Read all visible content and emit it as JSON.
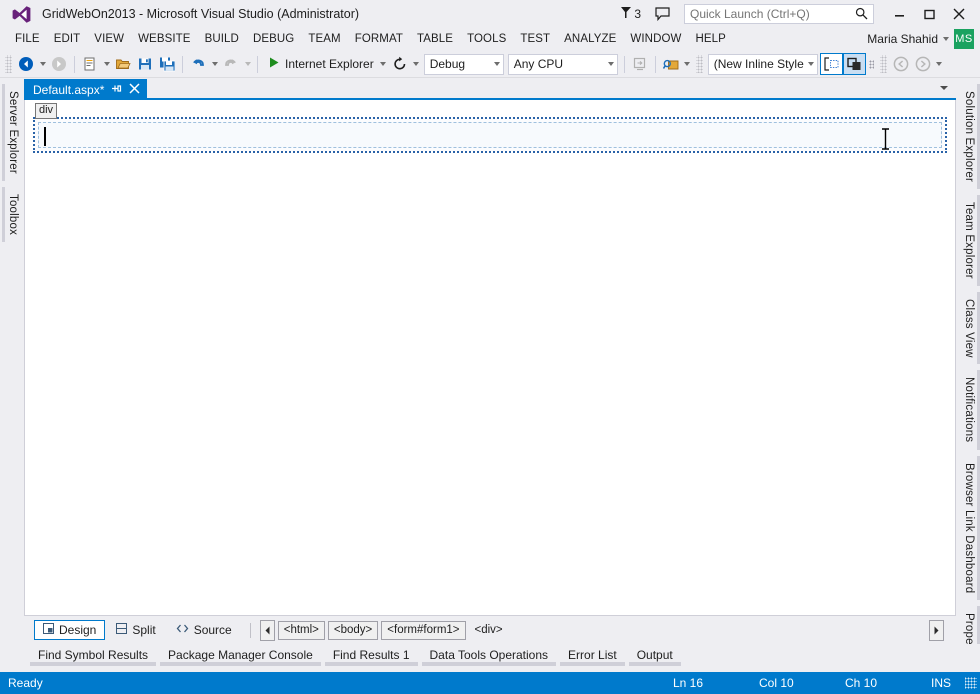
{
  "window": {
    "title": "GridWebOn2013 - Microsoft Visual Studio (Administrator)",
    "logo_icon": "visual-studio-logo",
    "minimize_label": "—",
    "maximize_label": "▢",
    "close_label": "✕"
  },
  "notifications": {
    "icon": "flag-icon",
    "count": "3"
  },
  "feedback": {
    "icon": "feedback-speech-bubble-icon"
  },
  "quick_launch": {
    "placeholder": "Quick Launch (Ctrl+Q)",
    "value": "",
    "icon": "search-icon"
  },
  "menu": {
    "items": [
      {
        "label": "FILE"
      },
      {
        "label": "EDIT"
      },
      {
        "label": "VIEW"
      },
      {
        "label": "WEBSITE"
      },
      {
        "label": "BUILD"
      },
      {
        "label": "DEBUG"
      },
      {
        "label": "TEAM"
      },
      {
        "label": "FORMAT"
      },
      {
        "label": "TABLE"
      },
      {
        "label": "TOOLS"
      },
      {
        "label": "TEST"
      },
      {
        "label": "ANALYZE"
      },
      {
        "label": "WINDOW"
      },
      {
        "label": "HELP"
      }
    ]
  },
  "account": {
    "name": "Maria Shahid",
    "initials": "MS",
    "avatar_color": "#1aa260"
  },
  "toolbar": {
    "nav_back_icon": "navigate-back-icon",
    "nav_forward_icon": "navigate-forward-icon",
    "new_item_icon": "new-item-icon",
    "open_file_icon": "open-file-icon",
    "save_icon": "save-icon",
    "save_all_icon": "save-all-icon",
    "undo_icon": "undo-icon",
    "redo_icon": "redo-icon",
    "start_debug_icon": "start-play-icon",
    "start_debug_label": "Internet Explorer",
    "refresh_icon": "refresh-icon",
    "configuration": "Debug",
    "platform": "Any CPU",
    "style_application": "(New Inline Style",
    "attach_icon": "attach-to-process-icon",
    "find_icon": "find-in-files-icon",
    "toggle_outline_icon": "show-block-selection-icon",
    "toggle_visual_aids_icon": "show-visual-aids-icon",
    "back_circle_icon": "back-circle-icon",
    "forward_circle_icon": "forward-circle-icon"
  },
  "left_dock": {
    "tabs": [
      {
        "label": "Server Explorer"
      },
      {
        "label": "Toolbox"
      }
    ]
  },
  "right_dock": {
    "tabs": [
      {
        "label": "Solution Explorer"
      },
      {
        "label": "Team Explorer"
      },
      {
        "label": "Class View"
      },
      {
        "label": "Notifications"
      },
      {
        "label": "Browser Link Dashboard"
      },
      {
        "label": "Properties"
      }
    ]
  },
  "document": {
    "tab_label": "Default.aspx*",
    "pin_icon": "pin-icon",
    "close_icon": "close-icon",
    "tab_list_icon": "tab-list-chevron-icon",
    "designer": {
      "tag_badge": "div",
      "content": "",
      "cursor_icon": "text-ibeam-cursor"
    }
  },
  "view_selector": {
    "buttons": [
      {
        "label": "Design",
        "icon": "design-view-icon",
        "active": true
      },
      {
        "label": "Split",
        "icon": "split-view-icon",
        "active": false
      },
      {
        "label": "Source",
        "icon": "source-view-icon",
        "active": false
      }
    ]
  },
  "tag_navigator": {
    "left_arrow_icon": "scroll-left-icon",
    "right_arrow_icon": "scroll-right-icon",
    "tags": [
      {
        "label": "<html>",
        "selected": false
      },
      {
        "label": "<body>",
        "selected": false
      },
      {
        "label": "<form#form1>",
        "selected": false
      },
      {
        "label": "<div>",
        "selected": true
      }
    ]
  },
  "bottom_tool_tabs": [
    {
      "label": "Find Symbol Results"
    },
    {
      "label": "Package Manager Console"
    },
    {
      "label": "Find Results 1"
    },
    {
      "label": "Data Tools Operations"
    },
    {
      "label": "Error List"
    },
    {
      "label": "Output"
    }
  ],
  "status_bar": {
    "state": "Ready",
    "line": "Ln 16",
    "column": "Col 10",
    "character": "Ch 10",
    "insert_mode": "INS",
    "background": "#007acc"
  }
}
